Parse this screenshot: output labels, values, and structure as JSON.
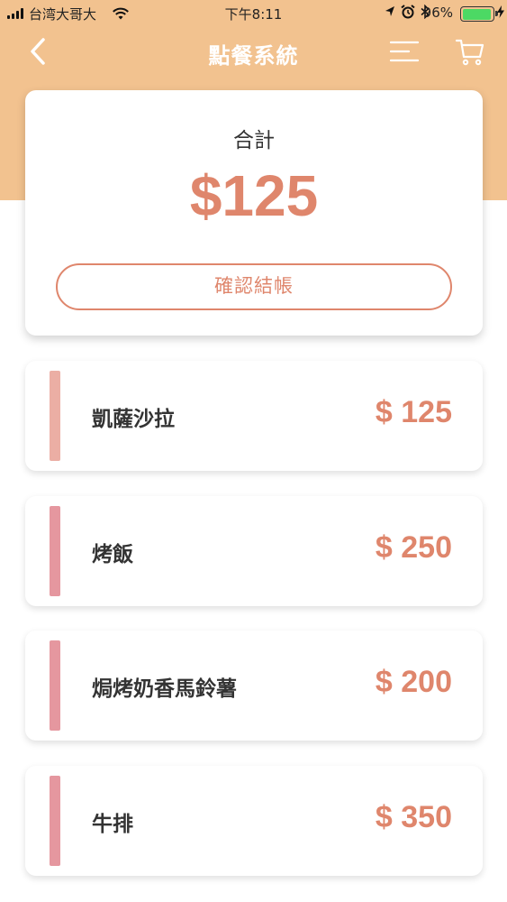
{
  "status_bar": {
    "carrier": "台湾大哥大",
    "time": "下午8:11",
    "battery": "96%",
    "battery_level": 0.96
  },
  "nav": {
    "title": "點餐系統",
    "icons": [
      "back-chevron-icon",
      "menu-icon",
      "cart-icon"
    ]
  },
  "summary": {
    "label": "合計",
    "amount": "$125",
    "checkout_label": "確認結帳"
  },
  "items": [
    {
      "name": "凱薩沙拉",
      "price": "$ 125",
      "accent": "#ebaea4"
    },
    {
      "name": "烤飯",
      "price": "$ 250",
      "accent": "#e5979f"
    },
    {
      "name": "焗烤奶香馬鈴薯",
      "price": "$ 200",
      "accent": "#e5979f"
    },
    {
      "name": "牛排",
      "price": "$ 350",
      "accent": "#e5979f"
    }
  ],
  "colors": {
    "header_bg": "#f2c28f",
    "accent": "#df866c"
  }
}
